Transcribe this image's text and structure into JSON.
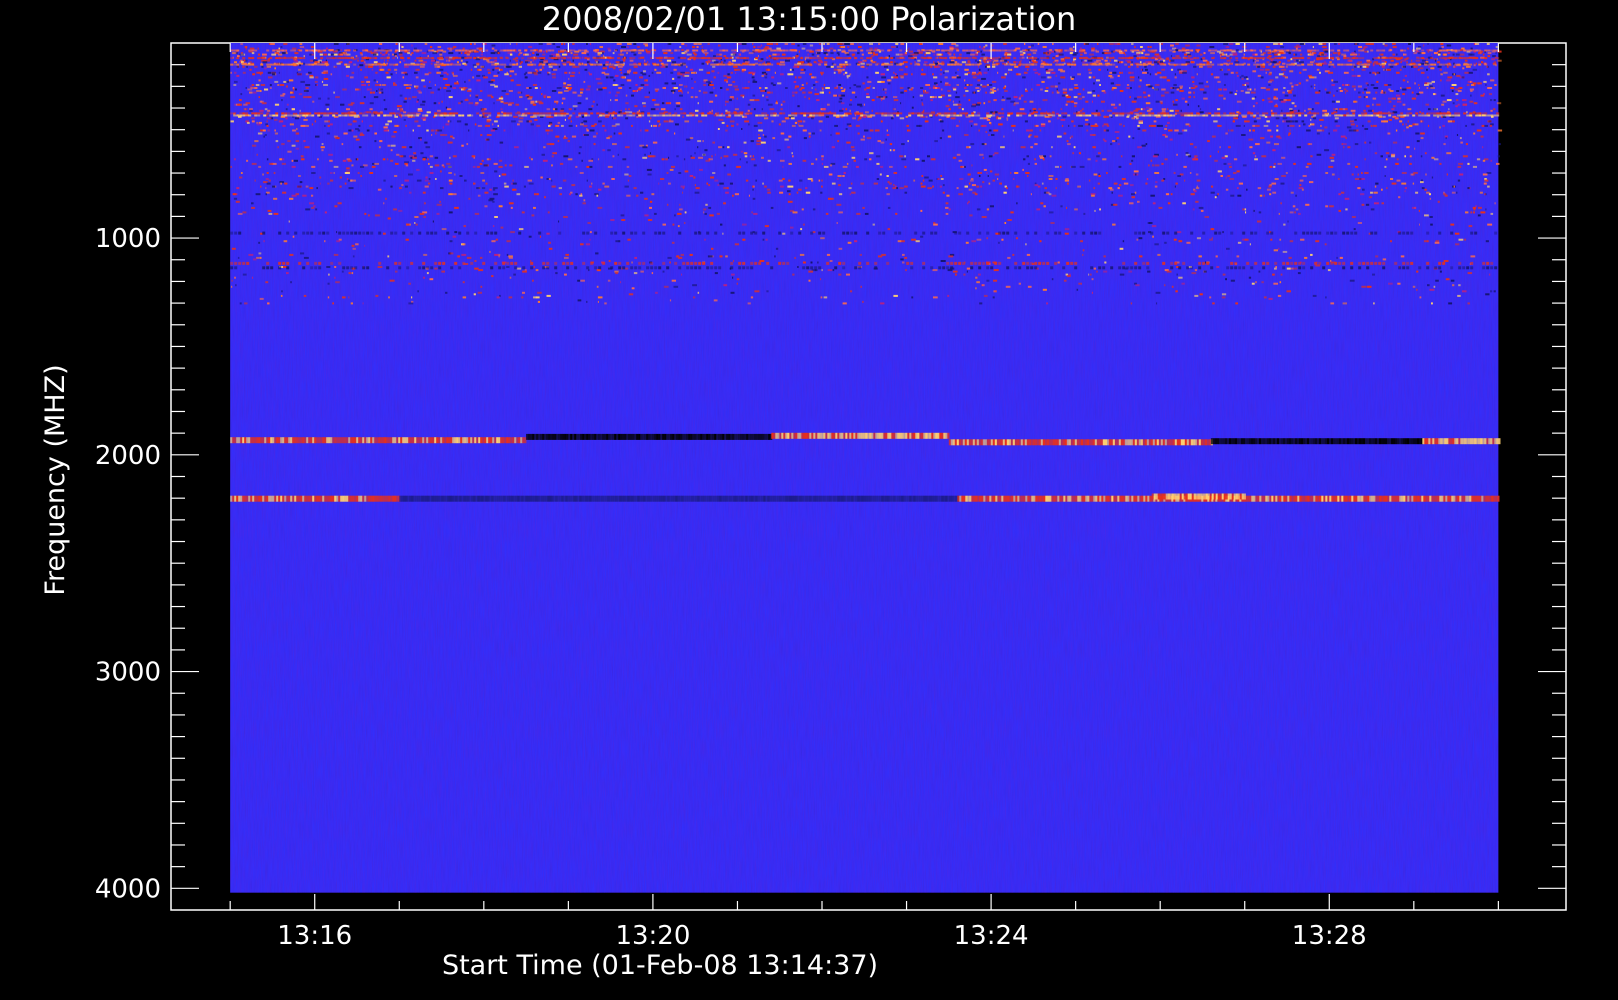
{
  "chart_data": {
    "type": "heatmap",
    "title": "2008/02/01 13:15:00 Polarization",
    "xlabel": "Start Time (01-Feb-08 13:14:37)",
    "ylabel": "Frequency (MHZ)",
    "x_ticks": [
      {
        "label": "13:16",
        "minutes": 16
      },
      {
        "label": "13:20",
        "minutes": 20
      },
      {
        "label": "13:24",
        "minutes": 24
      },
      {
        "label": "13:28",
        "minutes": 28
      }
    ],
    "y_ticks": [
      {
        "label": "1000",
        "value": 1000
      },
      {
        "label": "2000",
        "value": 2000
      },
      {
        "label": "3000",
        "value": 3000
      },
      {
        "label": "4000",
        "value": 4000
      }
    ],
    "xlim_minutes": [
      14.3,
      30.8
    ],
    "ylim": [
      100,
      4100
    ],
    "data_extent": {
      "t_start_minutes": 15.0,
      "t_end_minutes": 30.0,
      "f_min": 100,
      "f_max": 4020
    },
    "y_inverted": true,
    "colormap": "blue-red-yellow",
    "background_color": "#3030ff",
    "notable_bands": [
      {
        "freq": 1930,
        "t_start": 15.0,
        "t_end": 18.5,
        "level": "red"
      },
      {
        "freq": 1915,
        "t_start": 18.5,
        "t_end": 21.4,
        "level": "black"
      },
      {
        "freq": 1910,
        "t_start": 21.4,
        "t_end": 23.5,
        "level": "yellow"
      },
      {
        "freq": 1940,
        "t_start": 23.5,
        "t_end": 26.6,
        "level": "red"
      },
      {
        "freq": 1935,
        "t_start": 26.6,
        "t_end": 29.1,
        "level": "black"
      },
      {
        "freq": 1935,
        "t_start": 29.1,
        "t_end": 30.0,
        "level": "yellow"
      },
      {
        "freq": 2200,
        "t_start": 15.0,
        "t_end": 17.0,
        "level": "red"
      },
      {
        "freq": 2200,
        "t_start": 17.0,
        "t_end": 23.6,
        "level": "dark"
      },
      {
        "freq": 2200,
        "t_start": 23.6,
        "t_end": 30.0,
        "level": "red"
      },
      {
        "freq": 2190,
        "t_start": 25.9,
        "t_end": 27.0,
        "level": "yellow"
      }
    ]
  }
}
